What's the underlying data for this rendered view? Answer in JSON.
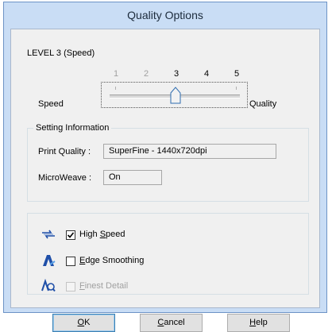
{
  "dialog": {
    "title": "Quality Options"
  },
  "level": {
    "label": "LEVEL 3 (Speed)",
    "ticks": [
      "1",
      "2",
      "3",
      "4",
      "5"
    ],
    "speed_label": "Speed",
    "quality_label": "Quality",
    "slider_value": 3,
    "slider_min": 1,
    "slider_max": 5
  },
  "setting_info": {
    "title": "Setting Information",
    "print_quality_label": "Print Quality :",
    "print_quality_value": "SuperFine - 1440x720dpi",
    "microweave_label": "MicroWeave :",
    "microweave_value": "On"
  },
  "options": {
    "high_speed": {
      "pre": "High ",
      "key": "S",
      "post": "peed",
      "checked": true,
      "enabled": true,
      "icon": "high-speed-icon"
    },
    "edge_smoothing": {
      "pre": "",
      "key": "E",
      "post": "dge Smoothing",
      "checked": false,
      "enabled": true,
      "icon": "edge-smoothing-icon"
    },
    "finest_detail": {
      "pre": "",
      "key": "F",
      "post": "inest Detail",
      "checked": false,
      "enabled": false,
      "icon": "finest-detail-icon"
    }
  },
  "buttons": {
    "ok": {
      "key": "O",
      "rest": "K"
    },
    "cancel": {
      "key": "C",
      "rest": "ancel"
    },
    "help": {
      "key": "H",
      "rest": "elp"
    }
  },
  "colors": {
    "titlebar": "#c9ddf5",
    "client_bg": "#f0f0f0",
    "default_button_border": "#3c7fb1"
  }
}
